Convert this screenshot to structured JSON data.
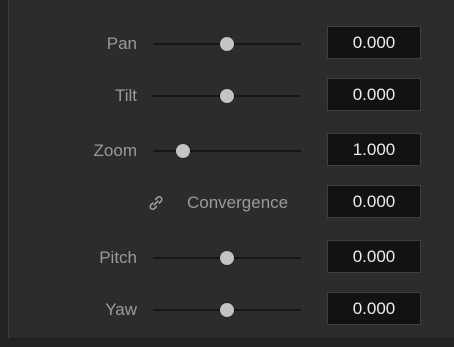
{
  "controls": [
    {
      "id": "pan",
      "label": "Pan",
      "value": "0.000",
      "slider_level": 0.5
    },
    {
      "id": "tilt",
      "label": "Tilt",
      "value": "0.000",
      "slider_level": 0.5
    },
    {
      "id": "zoom",
      "label": "Zoom",
      "value": "1.000",
      "slider_level": 0.2
    },
    {
      "id": "convergence",
      "label": "Convergence",
      "value": "0.000",
      "icon": "link-icon"
    },
    {
      "id": "pitch",
      "label": "Pitch",
      "value": "0.000",
      "slider_level": 0.5
    },
    {
      "id": "yaw",
      "label": "Yaw",
      "value": "0.000",
      "slider_level": 0.5
    }
  ]
}
